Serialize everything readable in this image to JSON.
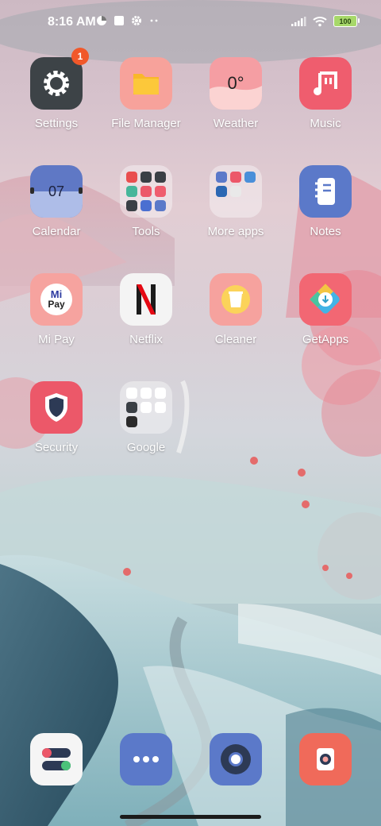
{
  "status_bar": {
    "time": "8:16 AM",
    "battery": "100",
    "left_icons": [
      "data-saver-icon",
      "square-notification-icon",
      "gear-icon",
      "more-dots-icon"
    ],
    "right_icons": [
      "signal-icon",
      "wifi-icon",
      "battery-icon"
    ]
  },
  "apps": [
    {
      "label": "Settings",
      "badge": "1",
      "icon": "settings-gear-icon",
      "color": "#3d4347"
    },
    {
      "label": "File Manager",
      "icon": "folder-icon",
      "color": "#f7a29b"
    },
    {
      "label": "Weather",
      "temp": "0°",
      "icon": "weather-icon",
      "color": "#f59ea3"
    },
    {
      "label": "Music",
      "icon": "music-note-icon",
      "color": "#ef5d6e"
    },
    {
      "label": "Calendar",
      "date": "07",
      "icon": "calendar-icon",
      "color": "#5f78c5"
    },
    {
      "label": "Tools",
      "icon": "folder-tools-icon"
    },
    {
      "label": "More apps",
      "icon": "folder-more-apps-icon"
    },
    {
      "label": "Notes",
      "icon": "notebook-icon",
      "color": "#5b79c9"
    },
    {
      "label": "Mi Pay",
      "brand_top": "Mi",
      "brand_bottom": "Pay",
      "icon": "mi-pay-icon",
      "color": "#f6a39f"
    },
    {
      "label": "Netflix",
      "icon": "netflix-n-icon",
      "color": "#f4f4f4"
    },
    {
      "label": "Cleaner",
      "icon": "trash-cup-icon",
      "color": "#f6a29e"
    },
    {
      "label": "GetApps",
      "icon": "getapps-icon",
      "color": "#f26773"
    },
    {
      "label": "Security",
      "icon": "shield-icon",
      "color": "#ec5869"
    },
    {
      "label": "Google",
      "icon": "folder-google-icon"
    }
  ],
  "dock": [
    {
      "icon": "phone-toggle-icon",
      "color": "#f5f5f5"
    },
    {
      "icon": "messaging-dots-icon",
      "color": "#5b79c9"
    },
    {
      "icon": "browser-icon",
      "color": "#5b79c9"
    },
    {
      "icon": "camera-icon",
      "color": "#f06a5a"
    }
  ]
}
